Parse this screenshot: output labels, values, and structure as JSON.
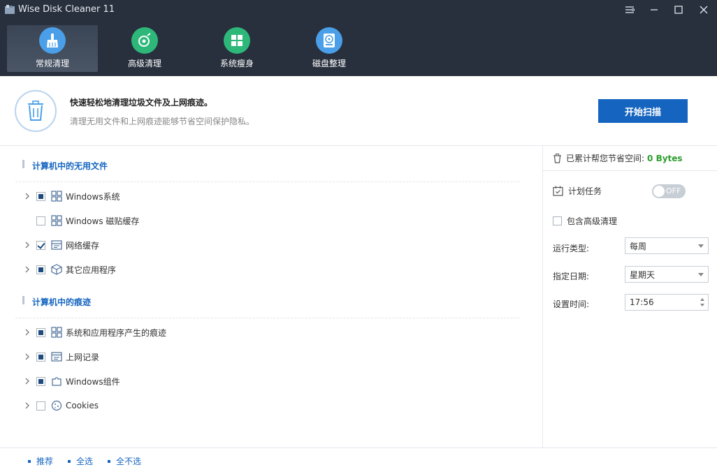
{
  "app": {
    "title": "Wise Disk Cleaner 11"
  },
  "nav": {
    "tabs": [
      {
        "label": "常规清理",
        "icon": "broom-icon",
        "color": "#4a9fe8"
      },
      {
        "label": "高级清理",
        "icon": "disk-search-icon",
        "color": "#2db87a"
      },
      {
        "label": "系统瘦身",
        "icon": "windows-icon",
        "color": "#2db87a"
      },
      {
        "label": "磁盘整理",
        "icon": "defrag-icon",
        "color": "#4a9fe8"
      }
    ]
  },
  "intro": {
    "title": "快速轻松地清理垃圾文件及上网痕迹。",
    "description": "清理无用文件和上网痕迹能够节省空间保护隐私。",
    "scan_button": "开始扫描"
  },
  "sections": [
    {
      "title": "计算机中的无用文件",
      "items": [
        {
          "label": "Windows系统",
          "state": "partial",
          "expandable": true,
          "icon": "windows-tiles-icon"
        },
        {
          "label": "Windows 磁贴缓存",
          "state": "unchecked",
          "expandable": false,
          "icon": "windows-tiles-icon"
        },
        {
          "label": "网络缓存",
          "state": "checked",
          "expandable": true,
          "icon": "network-cache-icon"
        },
        {
          "label": "其它应用程序",
          "state": "partial",
          "expandable": true,
          "icon": "package-icon"
        }
      ]
    },
    {
      "title": "计算机中的痕迹",
      "items": [
        {
          "label": "系统和应用程序产生的痕迹",
          "state": "partial",
          "expandable": true,
          "icon": "windows-tiles-icon"
        },
        {
          "label": "上网记录",
          "state": "partial",
          "expandable": true,
          "icon": "browser-history-icon"
        },
        {
          "label": "Windows组件",
          "state": "partial",
          "expandable": true,
          "icon": "puzzle-icon"
        },
        {
          "label": "Cookies",
          "state": "unchecked",
          "expandable": true,
          "icon": "cookie-icon"
        }
      ]
    }
  ],
  "right_panel": {
    "saved_label": "已累计帮您节省空间:",
    "saved_value": "0 Bytes",
    "schedule_label": "计划任务",
    "schedule_toggle": "OFF",
    "include_advanced": "包含高级清理",
    "run_type_label": "运行类型:",
    "run_type_value": "每周",
    "date_label": "指定日期:",
    "date_value": "星期天",
    "time_label": "设置时间:",
    "time_value": "17:56"
  },
  "bottom": {
    "recommend": "推荐",
    "select_all": "全选",
    "select_none": "全不选"
  },
  "colors": {
    "header_bg": "#28303d",
    "accent": "#1565c0",
    "saved_green": "#2e9e2e"
  }
}
